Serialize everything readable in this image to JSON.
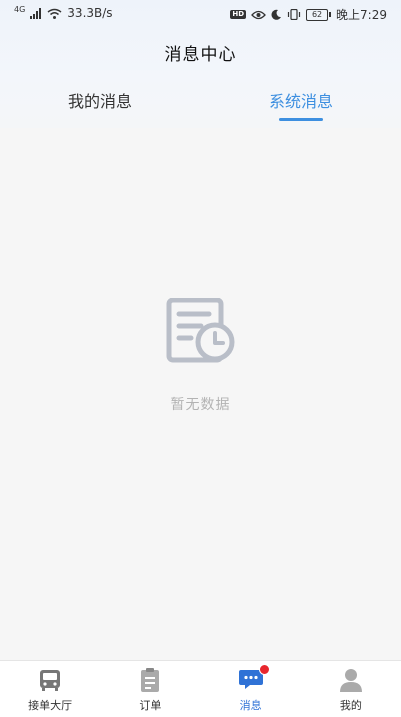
{
  "status_bar": {
    "signal_label": "4G",
    "net_speed": "33.3B/s",
    "hd_label": "HD",
    "battery_level": "62",
    "time": "晚上7:29"
  },
  "header": {
    "title": "消息中心"
  },
  "tabs": [
    {
      "label": "我的消息",
      "active": false
    },
    {
      "label": "系统消息",
      "active": true
    }
  ],
  "empty_state": {
    "icon": "document-clock-icon",
    "text": "暂无数据"
  },
  "bottom_nav": {
    "items": [
      {
        "label": "接单大厅",
        "icon": "bus-icon",
        "active": false
      },
      {
        "label": "订单",
        "icon": "clipboard-icon",
        "active": false
      },
      {
        "label": "消息",
        "icon": "chat-bubble-icon",
        "active": true,
        "has_badge": true
      },
      {
        "label": "我的",
        "icon": "person-icon",
        "active": false
      }
    ]
  },
  "colors": {
    "accent": "#3d8fe0",
    "nav_active": "#2f72d6",
    "badge": "#e8262d",
    "muted_text": "#b3b3b3"
  }
}
